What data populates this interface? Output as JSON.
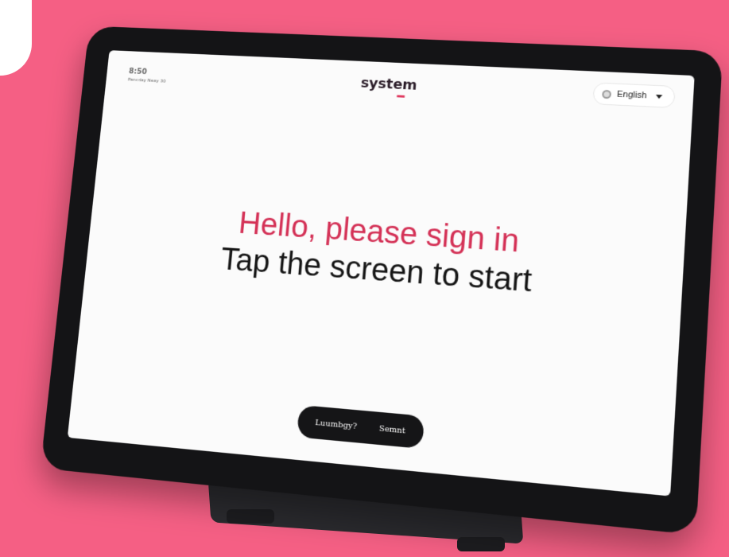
{
  "kiosk": {
    "time": "8:50",
    "date": "Pancday Neay 30",
    "logo": "system",
    "language": "English",
    "headline": "Hello, please sign in",
    "subline": "Tap the screen to start",
    "pill_left": "Luumbgy?",
    "pill_right": "Semnt"
  },
  "colors": {
    "background": "#f55f84",
    "accent": "#d43156",
    "bezel": "#141416",
    "screen": "#fbfbfb"
  },
  "icons": {
    "language": "globe-icon",
    "dropdown": "chevron-down-icon"
  }
}
